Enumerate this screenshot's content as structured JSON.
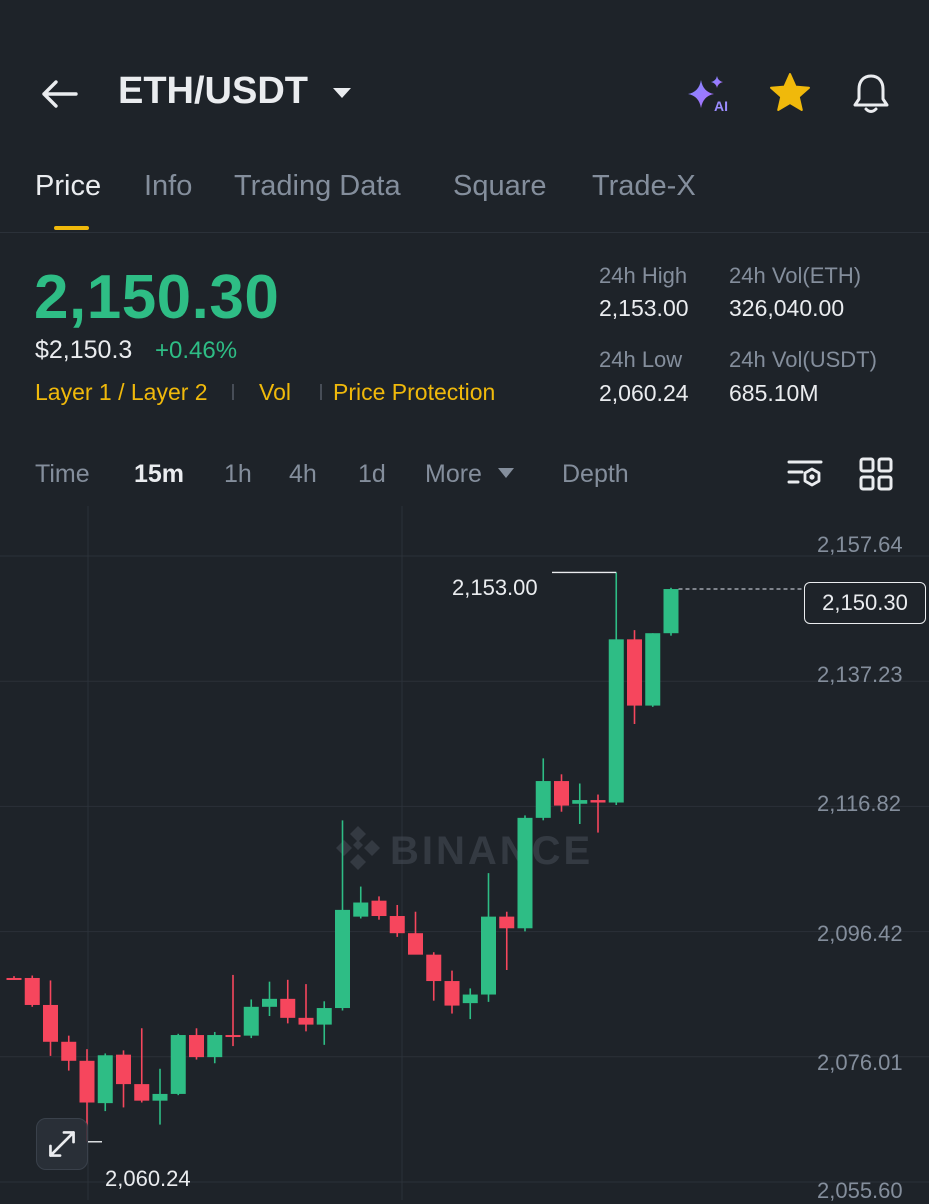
{
  "header": {
    "pair": "ETH/USDT",
    "ai_badge": "AI",
    "icons": [
      "back-arrow-icon",
      "chevron-down-icon",
      "ai-sparkle-icon",
      "star-icon",
      "bell-icon"
    ]
  },
  "tabs": [
    {
      "label": "Price",
      "active": true
    },
    {
      "label": "Info",
      "active": false
    },
    {
      "label": "Trading Data",
      "active": false
    },
    {
      "label": "Square",
      "active": false
    },
    {
      "label": "Trade-X",
      "active": false
    }
  ],
  "price": {
    "last": "2,150.30",
    "usd": "$2,150.3",
    "change": "+0.46%",
    "tags": [
      "Layer 1 / Layer 2",
      "Vol",
      "Price Protection"
    ]
  },
  "stats": {
    "high_label": "24h High",
    "high_value": "2,153.00",
    "vol_eth_label": "24h Vol(ETH)",
    "vol_eth_value": "326,040.00",
    "low_label": "24h Low",
    "low_value": "2,060.24",
    "vol_usdt_label": "24h Vol(USDT)",
    "vol_usdt_value": "685.10M"
  },
  "intervals": {
    "time": "Time",
    "m15": "15m",
    "h1": "1h",
    "h4": "4h",
    "d1": "1d",
    "more": "More",
    "depth": "Depth",
    "active": "15m"
  },
  "colors": {
    "up": "#2ebd85",
    "down": "#f6465d",
    "accent": "#f0b90b",
    "background": "#1e2329"
  },
  "chart_data": {
    "type": "candlestick",
    "interval": "15m",
    "watermark": "BINANCE",
    "y_ticks": [
      "2,157.64",
      "2,137.23",
      "2,116.82",
      "2,096.42",
      "2,076.01",
      "2,055.60"
    ],
    "ylim": [
      2055.6,
      2157.64
    ],
    "current_price": "2,150.30",
    "high_annotation": "2,153.00",
    "low_annotation": "2,060.24",
    "candles": [
      {
        "o": 2086.9,
        "h": 2087.2,
        "l": 2086.8,
        "c": 2086.8
      },
      {
        "o": 2086.9,
        "h": 2087.3,
        "l": 2082.2,
        "c": 2082.5
      },
      {
        "o": 2082.5,
        "h": 2086.5,
        "l": 2074.2,
        "c": 2076.5
      },
      {
        "o": 2076.5,
        "h": 2077.5,
        "l": 2071.8,
        "c": 2073.4
      },
      {
        "o": 2073.4,
        "h": 2075.3,
        "l": 2060.2,
        "c": 2066.6
      },
      {
        "o": 2066.5,
        "h": 2074.6,
        "l": 2065.2,
        "c": 2074.3
      },
      {
        "o": 2074.4,
        "h": 2075.1,
        "l": 2065.8,
        "c": 2069.6
      },
      {
        "o": 2069.6,
        "h": 2078.7,
        "l": 2066.6,
        "c": 2066.9
      },
      {
        "o": 2066.9,
        "h": 2072.1,
        "l": 2063.0,
        "c": 2068.0
      },
      {
        "o": 2068.0,
        "h": 2077.8,
        "l": 2067.8,
        "c": 2077.6
      },
      {
        "o": 2077.6,
        "h": 2078.7,
        "l": 2073.6,
        "c": 2074.0
      },
      {
        "o": 2074.0,
        "h": 2078.1,
        "l": 2073.0,
        "c": 2077.6
      },
      {
        "o": 2077.6,
        "h": 2087.4,
        "l": 2075.8,
        "c": 2077.5
      },
      {
        "o": 2077.5,
        "h": 2083.4,
        "l": 2077.1,
        "c": 2082.2
      },
      {
        "o": 2082.2,
        "h": 2086.3,
        "l": 2080.7,
        "c": 2083.5
      },
      {
        "o": 2083.5,
        "h": 2086.6,
        "l": 2079.5,
        "c": 2080.4
      },
      {
        "o": 2080.4,
        "h": 2085.9,
        "l": 2078.2,
        "c": 2079.3
      },
      {
        "o": 2079.3,
        "h": 2083.1,
        "l": 2076.0,
        "c": 2082.0
      },
      {
        "o": 2082.0,
        "h": 2112.6,
        "l": 2081.6,
        "c": 2098.0
      },
      {
        "o": 2096.9,
        "h": 2101.8,
        "l": 2096.6,
        "c": 2099.2
      },
      {
        "o": 2099.5,
        "h": 2100.2,
        "l": 2096.4,
        "c": 2097.0
      },
      {
        "o": 2097.0,
        "h": 2098.8,
        "l": 2093.6,
        "c": 2094.2
      },
      {
        "o": 2094.2,
        "h": 2097.7,
        "l": 2091.2,
        "c": 2090.7
      },
      {
        "o": 2090.7,
        "h": 2091.1,
        "l": 2083.2,
        "c": 2086.4
      },
      {
        "o": 2086.4,
        "h": 2088.1,
        "l": 2081.1,
        "c": 2082.4
      },
      {
        "o": 2082.8,
        "h": 2085.2,
        "l": 2080.2,
        "c": 2084.2
      },
      {
        "o": 2084.2,
        "h": 2104.0,
        "l": 2083.0,
        "c": 2096.9
      },
      {
        "o": 2096.9,
        "h": 2097.7,
        "l": 2088.2,
        "c": 2095.0
      },
      {
        "o": 2095.0,
        "h": 2113.4,
        "l": 2094.5,
        "c": 2113.0
      },
      {
        "o": 2113.0,
        "h": 2122.7,
        "l": 2112.6,
        "c": 2119.0
      },
      {
        "o": 2119.0,
        "h": 2120.1,
        "l": 2114.0,
        "c": 2115.0
      },
      {
        "o": 2115.3,
        "h": 2118.6,
        "l": 2112.0,
        "c": 2115.9
      },
      {
        "o": 2115.9,
        "h": 2116.8,
        "l": 2110.6,
        "c": 2115.5
      },
      {
        "o": 2115.5,
        "h": 2153.0,
        "l": 2115.1,
        "c": 2142.1
      },
      {
        "o": 2142.1,
        "h": 2143.6,
        "l": 2128.3,
        "c": 2131.3
      },
      {
        "o": 2131.3,
        "h": 2143.1,
        "l": 2131.1,
        "c": 2143.1
      },
      {
        "o": 2143.1,
        "h": 2150.5,
        "l": 2142.7,
        "c": 2150.3
      }
    ]
  }
}
